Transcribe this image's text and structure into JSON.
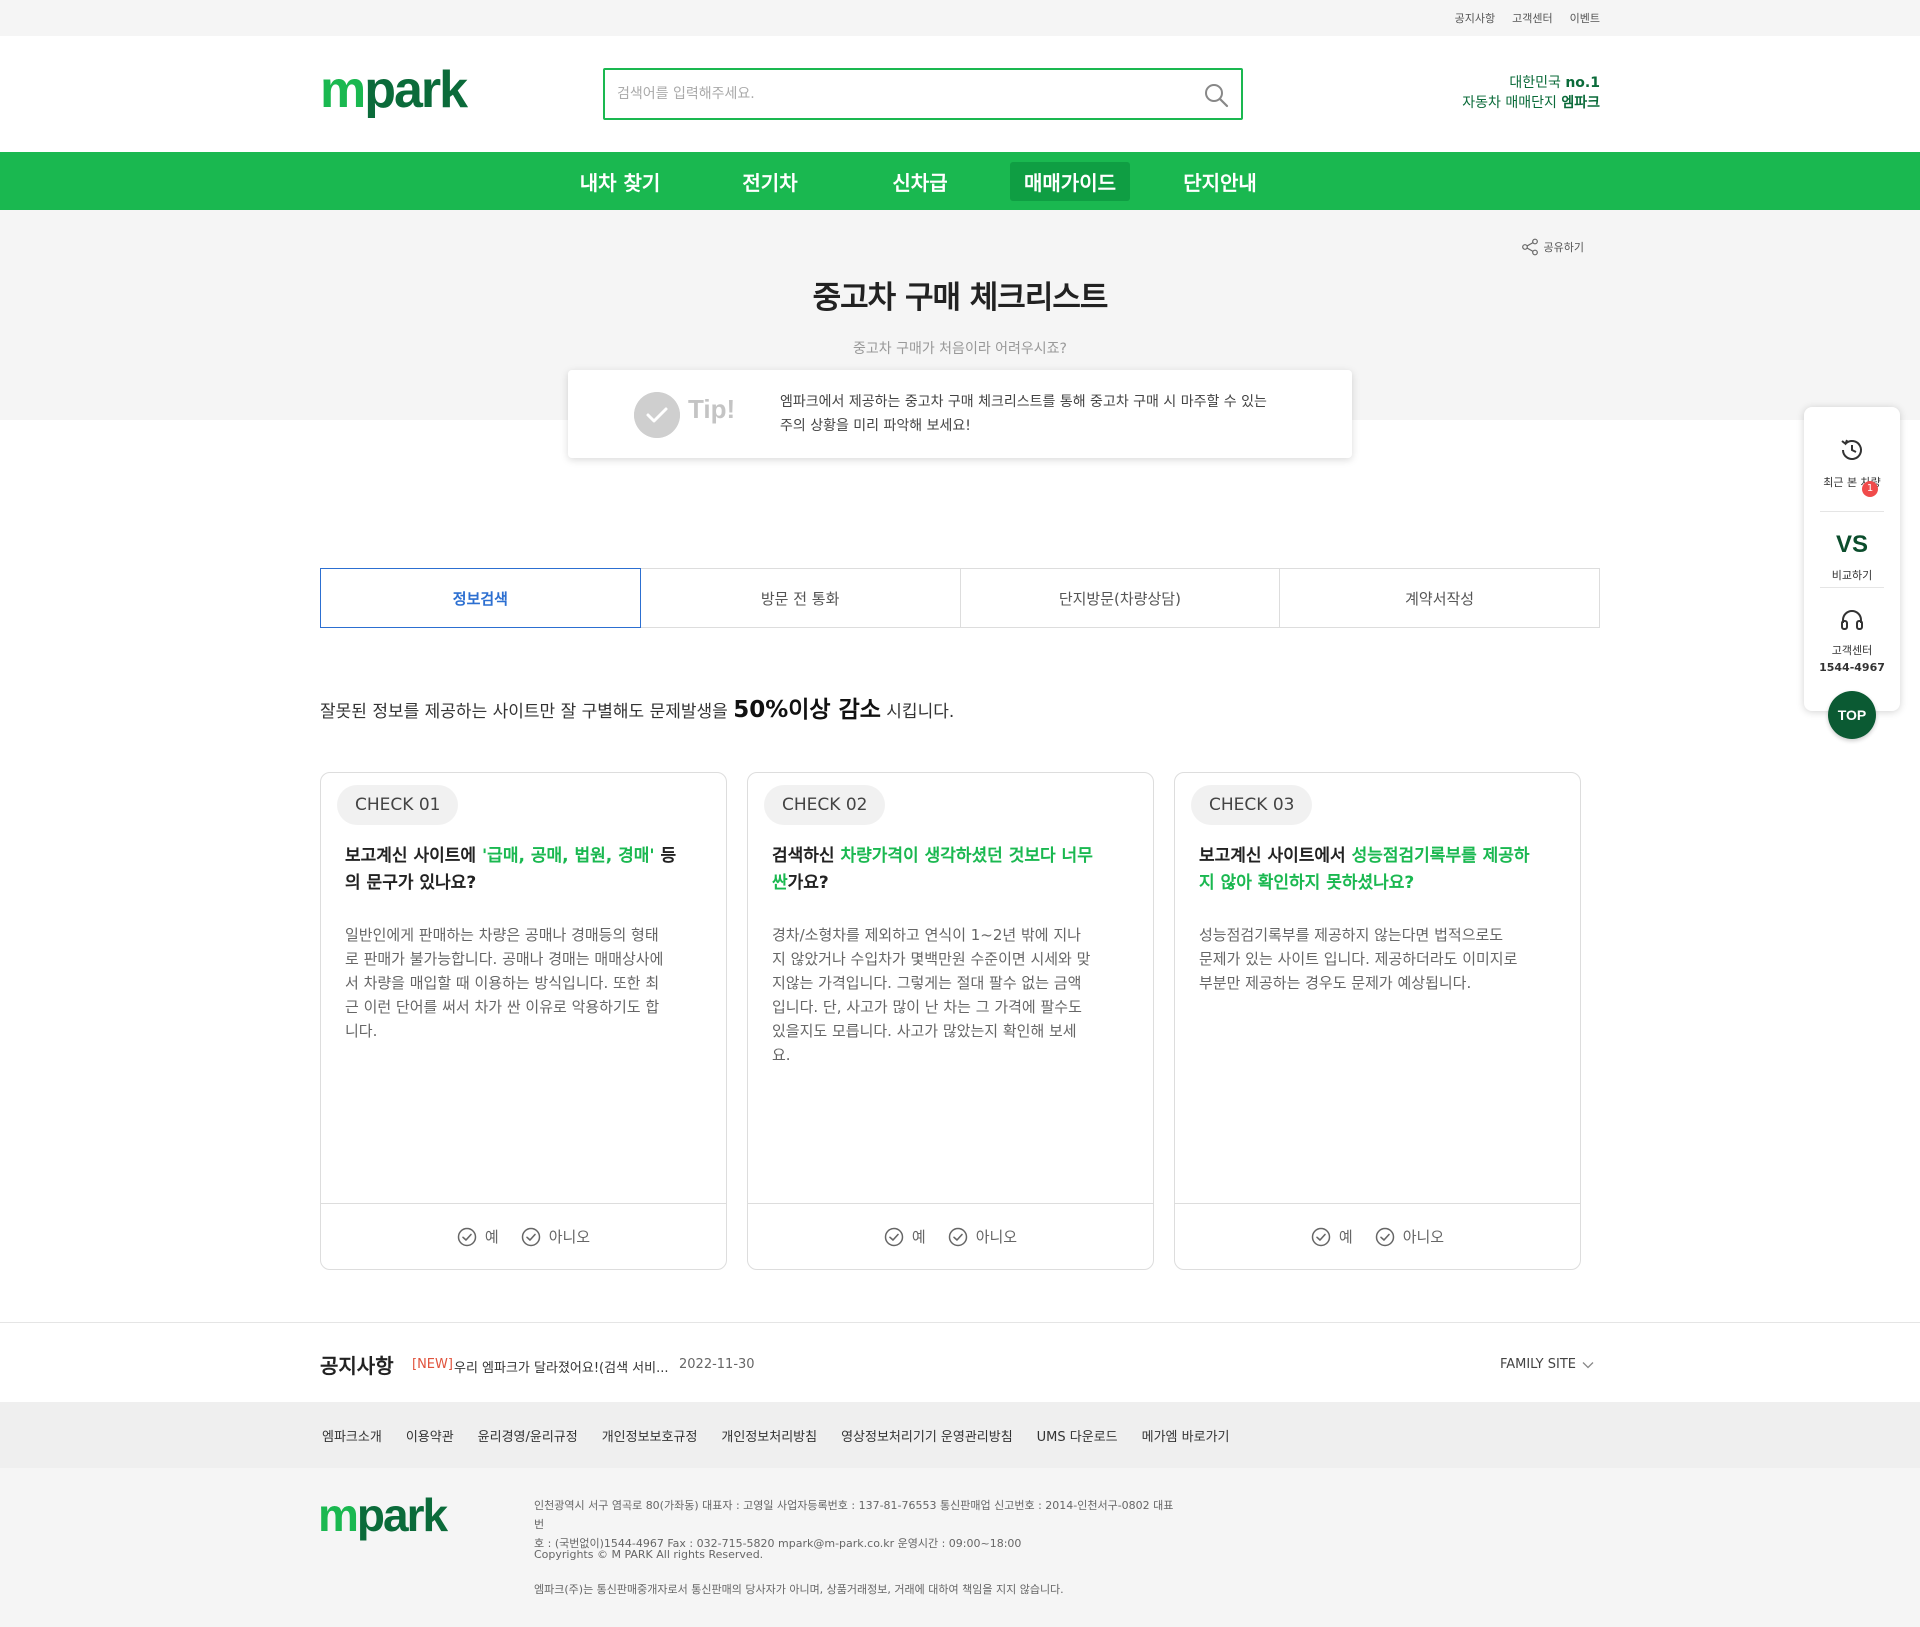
{
  "util": {
    "links": [
      "공지사항",
      "고객센터",
      "이벤트"
    ]
  },
  "header": {
    "logo_m": "m",
    "logo_park": "park",
    "search_placeholder": "검색어를 입력해주세요.",
    "slogan_line1": "대한민국",
    "slogan_no1": "no.1",
    "slogan_line2": "자동차 매매단지",
    "slogan_brand": "엠파크"
  },
  "gnb": {
    "items": [
      "내차 찾기",
      "전기차",
      "신차급",
      "매매가이드",
      "단지안내"
    ],
    "active_index": 3
  },
  "hero": {
    "share_label": "공유하기",
    "title": "중고차 구매 체크리스트",
    "subtitle": "중고차 구매가 처음이라 어려우시죠?",
    "tip_label": "Tip!",
    "tip_line1": "엠파크에서 제공하는 중고차 구매 체크리스트를 통해 중고차 구매 시 마주할 수 있는",
    "tip_line2": "주의 상황을 미리 파악해 보세요!"
  },
  "tabs": [
    "정보검색",
    "방문 전 통화",
    "단지방문(차량상담)",
    "계약서작성"
  ],
  "lead": {
    "before": "잘못된 정보를 제공하는 사이트만 잘 구별해도 문제발생을 ",
    "strong": "50%이상 감소",
    "after": " 시킵니다."
  },
  "cards": [
    {
      "badge": "CHECK 01",
      "q_pre": "보고계신 사이트에 ",
      "q_hl": "'급매, 공매, 법원, 경매'",
      "q_post": " 등의 문구가 있나요?",
      "desc": "일반인에게 판매하는 차량은 공매나 경매등의 형태로 판매가 불가능합니다. 공매나 경매는 매매상사에서 차량을 매입할 때 이용하는 방식입니다. 또한 최근 이런 단어를 써서 차가 싼 이유로 악용하기도 합니다.",
      "yes": "예",
      "no": "아니오"
    },
    {
      "badge": "CHECK 02",
      "q_pre": "검색하신 ",
      "q_hl": "차량가격이 생각하셨던 것보다 너무 싼",
      "q_post": "가요?",
      "desc": "경차/소형차를 제외하고 연식이 1~2년 밖에 지나지 않았거나 수입차가 몇백만원 수준이면 시세와 맞지않는 가격입니다. 그렇게는 절대 팔수 없는 금액입니다. 단, 사고가 많이 난 차는 그 가격에 팔수도 있을지도 모릅니다. 사고가 많았는지 확인해 보세요.",
      "yes": "예",
      "no": "아니오"
    },
    {
      "badge": "CHECK 03",
      "q_pre": "보고계신 사이트에서 ",
      "q_hl": "성능점검기록부를 제공하지 않아 확인하지 못하셨나요?",
      "q_post": "",
      "desc": "성능점검기록부를 제공하지 않는다면 법적으로도 문제가 있는 사이트 입니다. 제공하더라도 이미지로 부분만 제공하는 경우도 문제가 예상됩니다.",
      "yes": "예",
      "no": "아니오"
    }
  ],
  "notice": {
    "title": "공지사항",
    "new_tag": "[NEW]",
    "text": "우리 엠파크가 달라졌어요!(검색 서비...",
    "date": "2022-11-30",
    "family_site": "FAMILY SITE"
  },
  "footer": {
    "links": [
      "엠파크소개",
      "이용약관",
      "윤리경영/윤리규정",
      "개인정보보호규정",
      "개인정보처리방침",
      "영상정보처리기기 운영관리방침",
      "UMS 다운로드",
      "메가엠 바로가기"
    ],
    "info_line1": "인천광역시 서구 염곡로 80(가좌동) 대표자 : 고영일 사업자등록번호 : 137-81-76553 통신판매업 신고번호 : 2014-인천서구-0802 대표번",
    "info_line2": "호 : (국번없이)1544-4967 Fax : 032-715-5820 mpark@m-park.co.kr 운영시간 : 09:00~18:00",
    "copyright": "Copyrights © M PARK All rights Reserved.",
    "disclaimer": "엠파크(주)는 통신판매중개자로서 통신판매의 당사자가 아니며, 상품거래정보, 거래에 대하여 책임을 지지 않습니다."
  },
  "quick": {
    "recent_label": "최근 본 차량",
    "recent_count": "1",
    "vs_label": "VS",
    "compare_label": "비교하기",
    "cs_label": "고객센터",
    "cs_phone": "1544-4967",
    "top_label": "TOP"
  },
  "colors": {
    "brand_green": "#1ab850",
    "brand_dark": "#0b6b3a",
    "tab_active": "#2c6fd1",
    "new_tag": "#e0533d"
  }
}
